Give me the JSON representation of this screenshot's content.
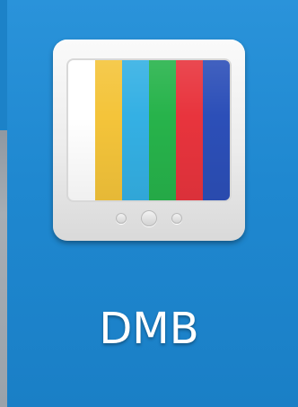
{
  "app": {
    "label": "DMB",
    "icon": "dmb-tv-icon"
  },
  "colors": {
    "background": "#1d86cf",
    "icon_frame": "#ececec",
    "label_text": "#ffffff"
  },
  "color_bars": [
    {
      "name": "white",
      "color": "#ffffff"
    },
    {
      "name": "yellow",
      "color": "#f4c43a"
    },
    {
      "name": "cyan",
      "color": "#34b0e4"
    },
    {
      "name": "green",
      "color": "#27b34b"
    },
    {
      "name": "red",
      "color": "#e8343d"
    },
    {
      "name": "blue",
      "color": "#2c4fb8"
    }
  ]
}
